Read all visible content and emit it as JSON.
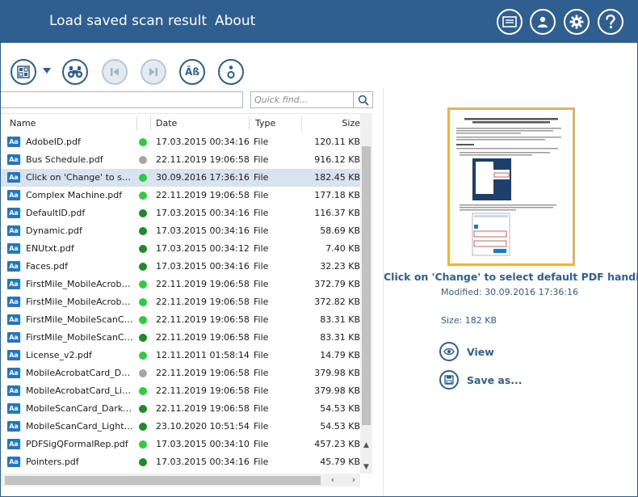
{
  "header": {
    "menu": [
      "Load saved scan result",
      "About"
    ],
    "buttons": [
      {
        "name": "hardware-icon-button"
      },
      {
        "name": "account-icon-button"
      },
      {
        "name": "settings-icon-button"
      },
      {
        "name": "help-icon-button"
      }
    ]
  },
  "toolbar": {
    "buttons": [
      {
        "name": "view-mode-button",
        "icon": "grid-icon",
        "enabled": true
      },
      {
        "name": "find-button",
        "icon": "binoculars-icon",
        "enabled": true
      },
      {
        "name": "previous-button",
        "icon": "previous-icon",
        "enabled": false
      },
      {
        "name": "next-button",
        "icon": "next-icon",
        "enabled": false
      },
      {
        "name": "case-toggle-button",
        "icon": "case-icon",
        "enabled": true,
        "label": "Āß"
      },
      {
        "name": "info-button",
        "icon": "info-icon",
        "enabled": true
      }
    ]
  },
  "search": {
    "quick_find_placeholder": "Quick find..."
  },
  "columns": {
    "name": "Name",
    "date": "Date",
    "type": "Type",
    "size": "Size"
  },
  "file_icon_label": "Aa",
  "files": [
    {
      "name": "AdobeID.pdf",
      "status": "good",
      "date": "17.03.2015 00:34:16",
      "type": "File",
      "size": "120.11 KB"
    },
    {
      "name": "Bus Schedule.pdf",
      "status": "unknown",
      "date": "22.11.2019 19:06:58",
      "type": "File",
      "size": "916.12 KB"
    },
    {
      "name": "Click on 'Change' to select default PDF handler.pdf",
      "status": "good",
      "date": "30.09.2016 17:36:16",
      "type": "File",
      "size": "182.45 KB",
      "selected": true
    },
    {
      "name": "Complex Machine.pdf",
      "status": "good",
      "date": "22.11.2019 19:06:58",
      "type": "File",
      "size": "177.18 KB"
    },
    {
      "name": "DefaultID.pdf",
      "status": "ok",
      "date": "17.03.2015 00:34:16",
      "type": "File",
      "size": "116.37 KB"
    },
    {
      "name": "Dynamic.pdf",
      "status": "ok",
      "date": "17.03.2015 00:34:16",
      "type": "File",
      "size": "58.69 KB"
    },
    {
      "name": "ENUtxt.pdf",
      "status": "ok",
      "date": "17.03.2015 00:34:12",
      "type": "File",
      "size": "7.40 KB"
    },
    {
      "name": "Faces.pdf",
      "status": "ok",
      "date": "17.03.2015 00:34:16",
      "type": "File",
      "size": "32.23 KB"
    },
    {
      "name": "FirstMile_MobileAcrobatCard_Dark.pdf",
      "status": "good",
      "date": "22.11.2019 19:06:58",
      "type": "File",
      "size": "372.79 KB"
    },
    {
      "name": "FirstMile_MobileAcrobatCard_Light.pdf",
      "status": "good",
      "date": "22.11.2019 19:06:58",
      "type": "File",
      "size": "372.82 KB"
    },
    {
      "name": "FirstMile_MobileScanCard_Dark.pdf",
      "status": "good",
      "date": "22.11.2019 19:06:58",
      "type": "File",
      "size": "83.31 KB"
    },
    {
      "name": "FirstMile_MobileScanCard_Light.pdf",
      "status": "ok",
      "date": "22.11.2019 19:06:58",
      "type": "File",
      "size": "83.31 KB"
    },
    {
      "name": "License_v2.pdf",
      "status": "good",
      "date": "12.11.2011 01:58:14",
      "type": "File",
      "size": "14.79 KB"
    },
    {
      "name": "MobileAcrobatCard_Dark.pdf",
      "status": "unknown",
      "date": "22.11.2019 19:06:58",
      "type": "File",
      "size": "379.98 KB"
    },
    {
      "name": "MobileAcrobatCard_Light.pdf",
      "status": "good",
      "date": "22.11.2019 19:06:58",
      "type": "File",
      "size": "379.98 KB"
    },
    {
      "name": "MobileScanCard_Dark.pdf",
      "status": "ok",
      "date": "22.11.2019 19:06:58",
      "type": "File",
      "size": "54.53 KB"
    },
    {
      "name": "MobileScanCard_Light.pdf",
      "status": "ok",
      "date": "23.10.2020 10:51:54",
      "type": "File",
      "size": "54.53 KB"
    },
    {
      "name": "PDFSigQFormalRep.pdf",
      "status": "good",
      "date": "17.03.2015 00:34:10",
      "type": "File",
      "size": "457.23 KB"
    },
    {
      "name": "Pointers.pdf",
      "status": "ok",
      "date": "17.03.2015 00:34:16",
      "type": "File",
      "size": "45.79 KB"
    }
  ],
  "status_colors": {
    "good": "#2ecc40",
    "ok": "#1e8a2a",
    "unknown": "#a5a5a5"
  },
  "preview": {
    "title": "Click on 'Change' to select default PDF handler.pdf",
    "modified": "Modified: 30.09.2016 17:36:16",
    "size": "Size: 182 KB",
    "actions": [
      {
        "name": "view-button",
        "icon": "eye-icon",
        "label": "View"
      },
      {
        "name": "save-as-button",
        "icon": "floppy-icon",
        "label": "Save as..."
      }
    ]
  },
  "colors": {
    "accent": "#2f5f91",
    "highlight": "#e6b54f",
    "selection": "#d9e3ef"
  }
}
